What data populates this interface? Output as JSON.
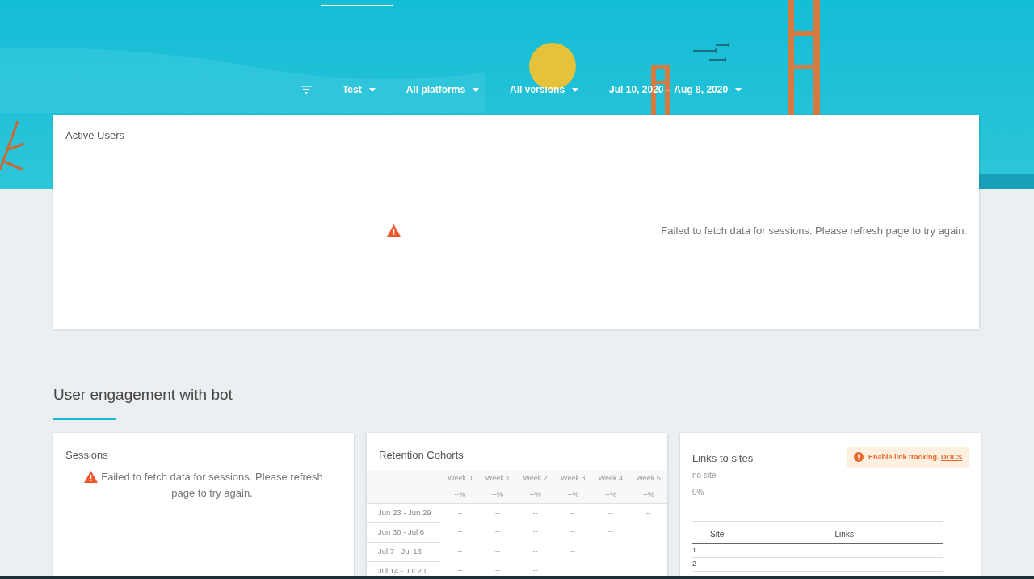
{
  "filters": [
    {
      "label": "Test"
    },
    {
      "label": "All platforms"
    },
    {
      "label": "All versions"
    },
    {
      "label": "Jul 10, 2020 – Aug 8, 2020"
    }
  ],
  "active_users": {
    "title": "Active Users",
    "error": "Failed to fetch data for sessions. Please refresh page to try again."
  },
  "section_title": "User engagement with bot",
  "sessions": {
    "title": "Sessions",
    "error": "Failed to fetch data for sessions. Please refresh page to try again."
  },
  "retention": {
    "title": "Retention Cohorts",
    "columns": [
      "Week 0",
      "Week 1",
      "Week 2",
      "Week 3",
      "Week 4",
      "Week 5"
    ],
    "percentages": [
      "--%",
      "--%",
      "--%",
      "--%",
      "--%",
      "--%"
    ],
    "rows": [
      {
        "label": "Jun 23 - Jun 29",
        "cells": [
          "--",
          "--",
          "--",
          "--",
          "--",
          "--"
        ]
      },
      {
        "label": "Jun 30 - Jul 6",
        "cells": [
          "--",
          "--",
          "--",
          "--",
          "--"
        ]
      },
      {
        "label": "Jul 7 - Jul 13",
        "cells": [
          "--",
          "--",
          "--",
          "--"
        ]
      },
      {
        "label": "Jul 14 - Jul 20",
        "cells": [
          "--",
          "--",
          "--"
        ]
      }
    ]
  },
  "links": {
    "title": "Links to sites",
    "notice": "Enable link tracking.",
    "notice_link": "DOCS",
    "site_name": "no site",
    "site_share": "0%",
    "columns": [
      "Site",
      "Links"
    ],
    "rows": [
      "1",
      "2"
    ]
  }
}
